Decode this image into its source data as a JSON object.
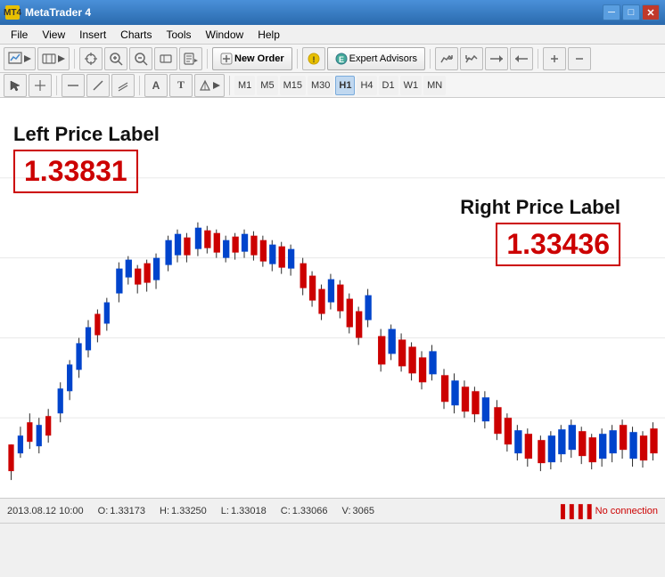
{
  "titleBar": {
    "title": "MetaTrader 4",
    "icon": "MT4",
    "controls": [
      "minimize",
      "maximize",
      "close"
    ]
  },
  "menuBar": {
    "items": [
      "File",
      "View",
      "Insert",
      "Charts",
      "Tools",
      "Window",
      "Help"
    ]
  },
  "toolbar1": {
    "buttons": [
      "new-chart",
      "profile",
      "crosshair",
      "zoom-in",
      "zoom-out",
      "properties"
    ],
    "newOrderLabel": "New Order",
    "expertAdvisorsLabel": "Expert Advisors"
  },
  "toolbar2": {
    "drawingTools": [
      "arrow",
      "crosshair",
      "horizontal",
      "trendline",
      "channels",
      "text",
      "label",
      "gann"
    ],
    "timeframes": [
      {
        "label": "M1",
        "active": false
      },
      {
        "label": "M5",
        "active": false
      },
      {
        "label": "M15",
        "active": false
      },
      {
        "label": "M30",
        "active": false
      },
      {
        "label": "H1",
        "active": true
      },
      {
        "label": "H4",
        "active": false
      },
      {
        "label": "D1",
        "active": false
      },
      {
        "label": "W1",
        "active": false
      },
      {
        "label": "MN",
        "active": false
      }
    ]
  },
  "chart": {
    "leftPriceLabel": {
      "title": "Left Price Label",
      "value": "1.33831"
    },
    "rightPriceLabel": {
      "title": "Right Price Label",
      "value": "1.33436"
    }
  },
  "statusBar": {
    "datetime": "2013.08.12 10:00",
    "open": {
      "label": "O:",
      "value": "1.33173"
    },
    "high": {
      "label": "H:",
      "value": "1.33250"
    },
    "low": {
      "label": "L:",
      "value": "1.33018"
    },
    "close": {
      "label": "C:",
      "value": "1.33066"
    },
    "volume": {
      "label": "V:",
      "value": "3065"
    },
    "connection": "No connection"
  }
}
